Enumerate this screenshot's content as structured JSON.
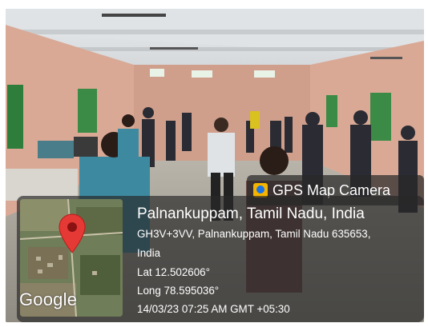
{
  "badge": {
    "icon": "gps-map-camera-icon",
    "title": "GPS Map Camera"
  },
  "location": {
    "place": "Palnankuppam, Tamil Nadu, India",
    "address_line1": "GH3V+3VV, Palnankuppam, Tamil Nadu 635653,",
    "address_line2": "India",
    "latitude": "Lat 12.502606°",
    "longitude": "Long 78.595036°",
    "timestamp": "14/03/23 07:25 AM GMT +05:30"
  },
  "map": {
    "logo_text": "Google",
    "pin_color": "#e53935"
  }
}
